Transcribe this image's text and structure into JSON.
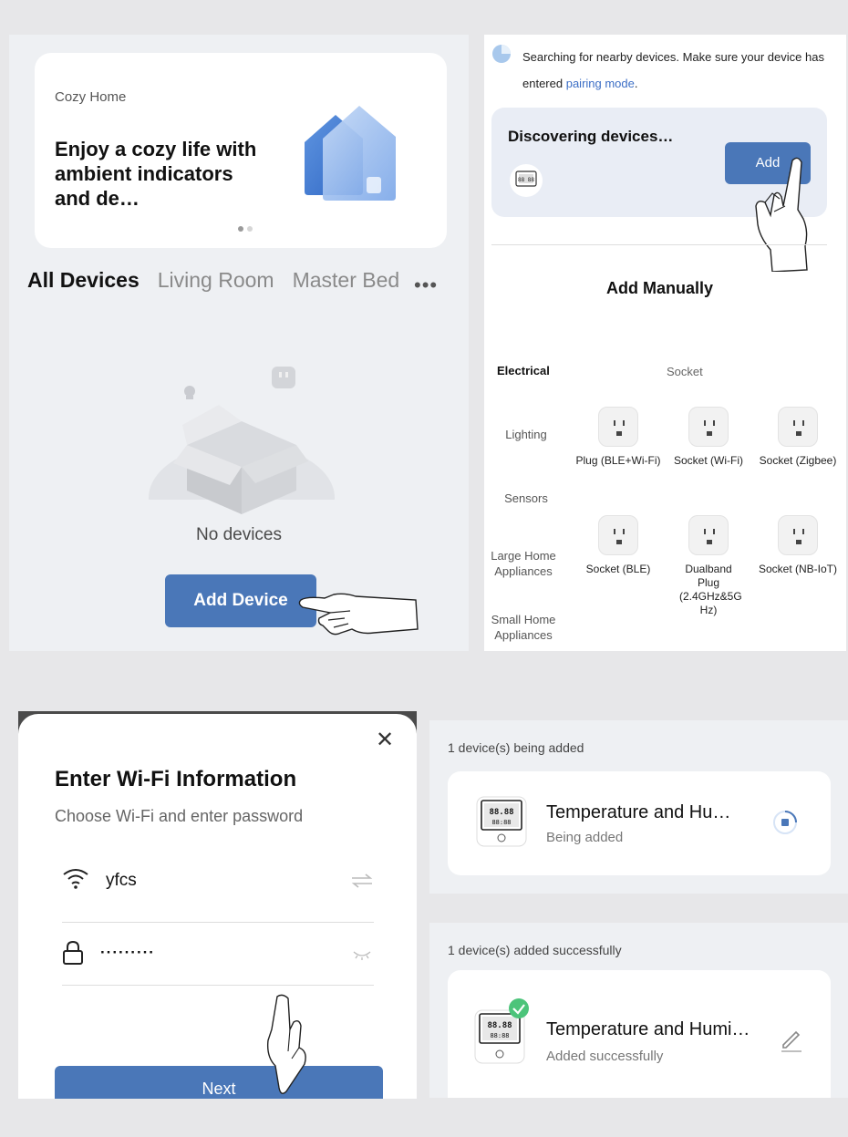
{
  "home": {
    "banner": {
      "subtitle": "Cozy Home",
      "title": "Enjoy a cozy life with ambient indicators and de…"
    },
    "tabs": [
      "All Devices",
      "Living Room",
      "Master Bed"
    ],
    "more_label": "•••",
    "empty_text": "No devices",
    "add_device_label": "Add Device"
  },
  "discover": {
    "search_text": "Searching for nearby devices. Make sure your device has entered",
    "pairing_link": "pairing mode",
    "search_suffix": ".",
    "card_title": "Discovering devices…",
    "add_label": "Add",
    "manual_title": "Add Manually",
    "categories": [
      "Electrical",
      "Lighting",
      "Sensors",
      "Large Home Appliances",
      "Small Home Appliances"
    ],
    "socket_header": "Socket",
    "devices": [
      {
        "name": "Plug (BLE+Wi-Fi)"
      },
      {
        "name": "Socket (Wi-Fi)"
      },
      {
        "name": "Socket (Zigbee)"
      },
      {
        "name": "Socket (BLE)"
      },
      {
        "name": "Dualband Plug (2.4GHz&5G Hz)"
      },
      {
        "name": "Socket (NB-IoT)"
      }
    ]
  },
  "wifi": {
    "close_label": "✕",
    "title": "Enter Wi-Fi Information",
    "subtitle": "Choose Wi-Fi and enter password",
    "ssid": "yfcs",
    "password_mask": "·········",
    "next_label": "Next"
  },
  "adding": {
    "section": "1 device(s) being added",
    "device_name": "Temperature and Hu…",
    "status": "Being added"
  },
  "added": {
    "section": "1 device(s) added successfully",
    "device_name": "Temperature and Humi…",
    "status": "Added successfully"
  },
  "colors": {
    "accent": "#4a77b8",
    "link": "#3d6fc6",
    "success": "#4cc47a"
  }
}
